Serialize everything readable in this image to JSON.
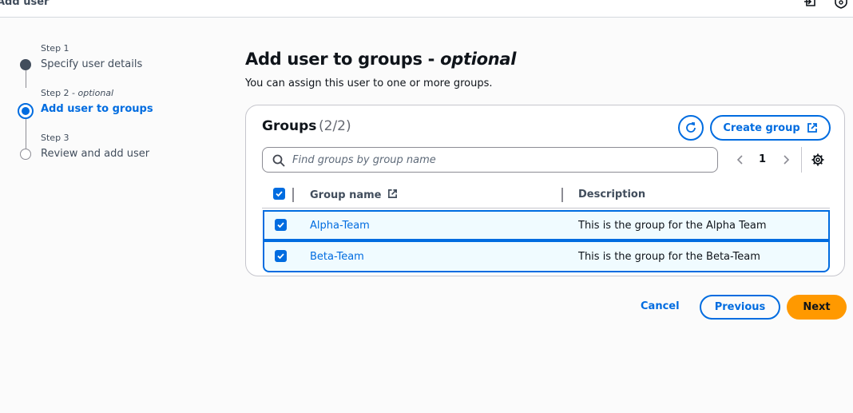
{
  "topbar": {
    "title": "Add user",
    "icons": [
      "export-icon",
      "shield-settings-icon"
    ]
  },
  "steps": [
    {
      "small": "Step 1",
      "label": "Specify user details",
      "state": "completed"
    },
    {
      "small": "Step 2",
      "small_optional": "optional",
      "label": "Add user to groups",
      "state": "current"
    },
    {
      "small": "Step 3",
      "label": "Review and add user",
      "state": "upcoming"
    }
  ],
  "colors": {
    "accent": "#006ce0",
    "completed": "#414d5c",
    "primary_button": "#ff9900",
    "selected_row": "#f0fbff"
  },
  "page": {
    "title": "Add user to groups - ",
    "title_optional": "optional",
    "subtitle": "You can assign this user to one or more groups."
  },
  "groups": {
    "title": "Groups",
    "count": "(2/2)",
    "refresh_icon": "refresh-icon",
    "create_label": "Create group",
    "search_placeholder": "Find groups by group name",
    "page_number": "1",
    "columns": {
      "name": "Group name",
      "description": "Description"
    },
    "rows": [
      {
        "name": "Alpha-Team",
        "description": "This is the group for the Alpha Team",
        "checked": true
      },
      {
        "name": "Beta-Team",
        "description": "This is the group for the Beta-Team",
        "checked": true
      }
    ]
  },
  "actions": {
    "cancel": "Cancel",
    "previous": "Previous",
    "next": "Next"
  }
}
